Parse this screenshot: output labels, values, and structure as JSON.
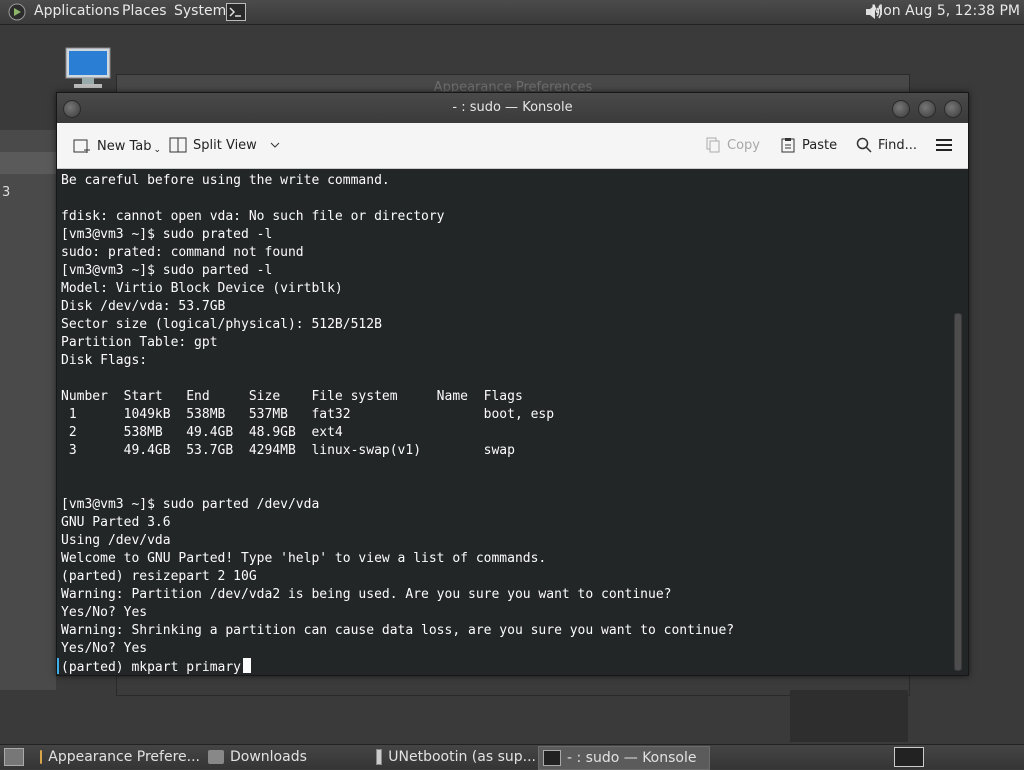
{
  "top_panel": {
    "applications": "Applications",
    "places": "Places",
    "system": "System",
    "clock": "Mon Aug  5, 12:38 PM"
  },
  "background_window": {
    "title": "Appearance Preferences",
    "left_text": "3"
  },
  "konsole": {
    "title": "- : sudo — Konsole",
    "toolbar": {
      "new_tab": "New Tab",
      "split_view": "Split View",
      "copy": "Copy",
      "paste": "Paste",
      "find": "Find..."
    },
    "terminal": {
      "lines": [
        "Be careful before using the write command.",
        "",
        "fdisk: cannot open vda: No such file or directory",
        "[vm3@vm3 ~]$ sudo prated -l",
        "sudo: prated: command not found",
        "[vm3@vm3 ~]$ sudo parted -l",
        "Model: Virtio Block Device (virtblk)",
        "Disk /dev/vda: 53.7GB",
        "Sector size (logical/physical): 512B/512B",
        "Partition Table: gpt",
        "Disk Flags:",
        "",
        "Number  Start   End     Size    File system     Name  Flags",
        " 1      1049kB  538MB   537MB   fat32                 boot, esp",
        " 2      538MB   49.4GB  48.9GB  ext4",
        " 3      49.4GB  53.7GB  4294MB  linux-swap(v1)        swap",
        "",
        "",
        "[vm3@vm3 ~]$ sudo parted /dev/vda",
        "GNU Parted 3.6",
        "Using /dev/vda",
        "Welcome to GNU Parted! Type 'help' to view a list of commands.",
        "(parted) resizepart 2 10G",
        "Warning: Partition /dev/vda2 is being used. Are you sure you want to continue?",
        "Yes/No? Yes",
        "Warning: Shrinking a partition can cause data loss, are you sure you want to continue?",
        "Yes/No? Yes"
      ],
      "prompt_line": "(parted) mkpart primary"
    }
  },
  "taskbar": {
    "tasks": [
      "Appearance Prefere...",
      "Downloads",
      "UNetbootin (as sup...",
      "- : sudo — Konsole"
    ]
  },
  "icons": {
    "apps": "apps-menu-icon",
    "terminal_launcher": "terminal-icon",
    "volume": "volume-icon",
    "computer": "computer-icon"
  }
}
